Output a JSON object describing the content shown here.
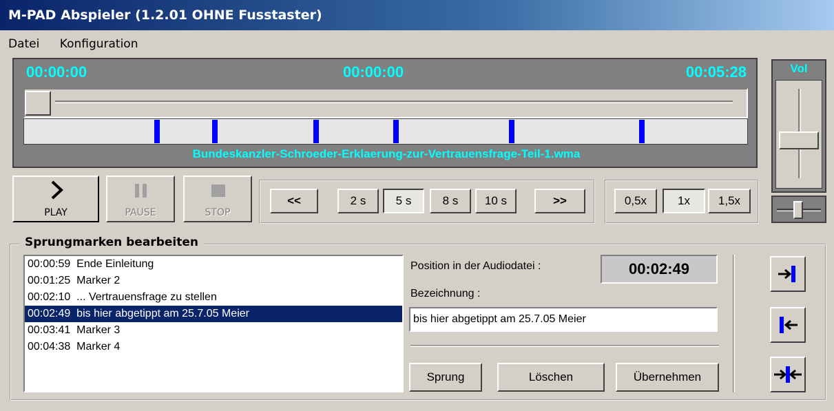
{
  "window": {
    "title": "M-PAD Abspieler (1.2.01  OHNE Fusstaster)"
  },
  "menu": {
    "items": [
      "Datei",
      "Konfiguration"
    ]
  },
  "player": {
    "time_left": "00:00:00",
    "time_center": "00:00:00",
    "time_right": "00:05:28",
    "position_fraction": 0.0,
    "marker_fractions": [
      0.18,
      0.26,
      0.4,
      0.51,
      0.67,
      0.85
    ],
    "filename": "Bundeskanzler-Schroeder-Erklaerung-zur-Vertrauensfrage-Teil-1.wma"
  },
  "transport": {
    "play": "PLAY",
    "pause": "PAUSE",
    "stop": "STOP"
  },
  "seek": {
    "back": "<<",
    "forward": ">>",
    "steps": [
      "2 s",
      "5 s",
      "8 s",
      "10 s"
    ],
    "selected_step": "5 s"
  },
  "speed": {
    "options": [
      "0,5x",
      "1x",
      "1,5x"
    ],
    "selected": "1x"
  },
  "volume": {
    "title": "Vol",
    "level": 0.45
  },
  "markers": {
    "legend": "Sprungmarken bearbeiten",
    "items": [
      "00:00:59  Ende Einleitung",
      "00:01:25  Marker 2",
      "00:02:10  ... Vertrauensfrage zu stellen",
      "00:02:49  bis hier abgetippt am 25.7.05 Meier",
      "00:03:41  Marker 3",
      "00:04:38  Marker 4"
    ],
    "selected_index": 3,
    "position_label": "Position in der Audiodatei :",
    "position_value": "00:02:49",
    "name_label": "Bezeichnung :",
    "name_value": "bis hier abgetippt am 25.7.05 Meier",
    "buttons": {
      "jump": "Sprung",
      "delete": "Löschen",
      "apply": "Übernehmen"
    }
  },
  "colors": {
    "title_bar": "#0a246a",
    "time_text": "#00ffff",
    "marker": "#0000ff",
    "selection": "#0a246a"
  }
}
